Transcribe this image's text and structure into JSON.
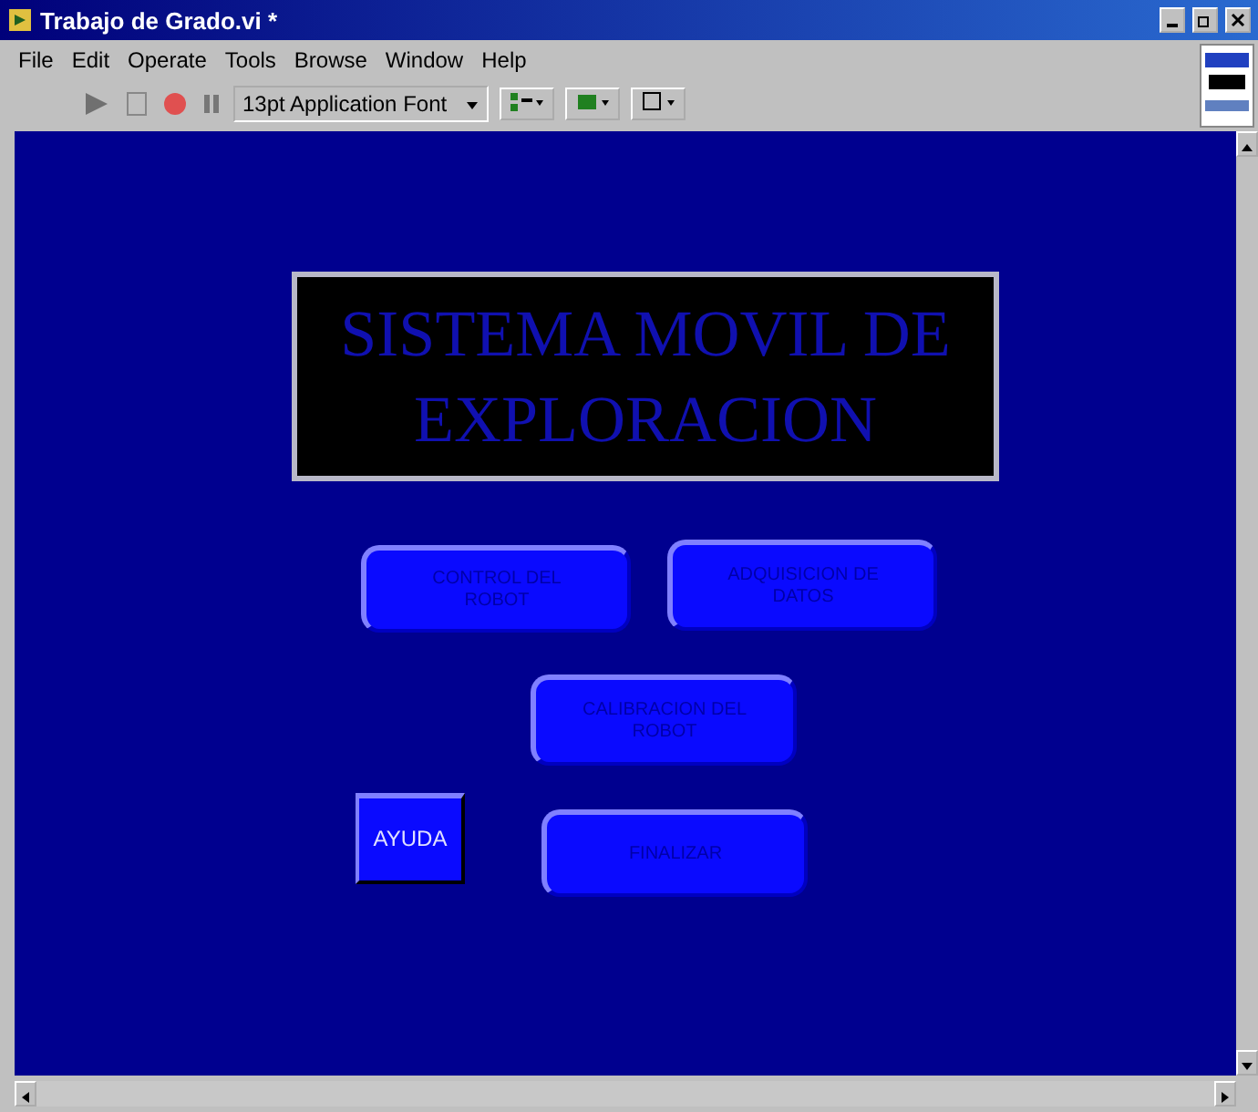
{
  "window": {
    "title": "Trabajo de Grado.vi *"
  },
  "menu": [
    "File",
    "Edit",
    "Operate",
    "Tools",
    "Browse",
    "Window",
    "Help"
  ],
  "toolbar": {
    "font": "13pt Application Font"
  },
  "panel": {
    "title": "SISTEMA MOVIL DE EXPLORACION",
    "buttons": [
      {
        "kind": "rounded",
        "label": "CONTROL DEL ROBOT"
      },
      {
        "kind": "rounded",
        "label": "ADQUISICION DE DATOS"
      },
      {
        "kind": "rounded",
        "label": "CALIBRACION DEL ROBOT"
      },
      {
        "kind": "square",
        "label": "AYUDA"
      },
      {
        "kind": "rounded",
        "label": "FINALIZAR"
      }
    ]
  }
}
